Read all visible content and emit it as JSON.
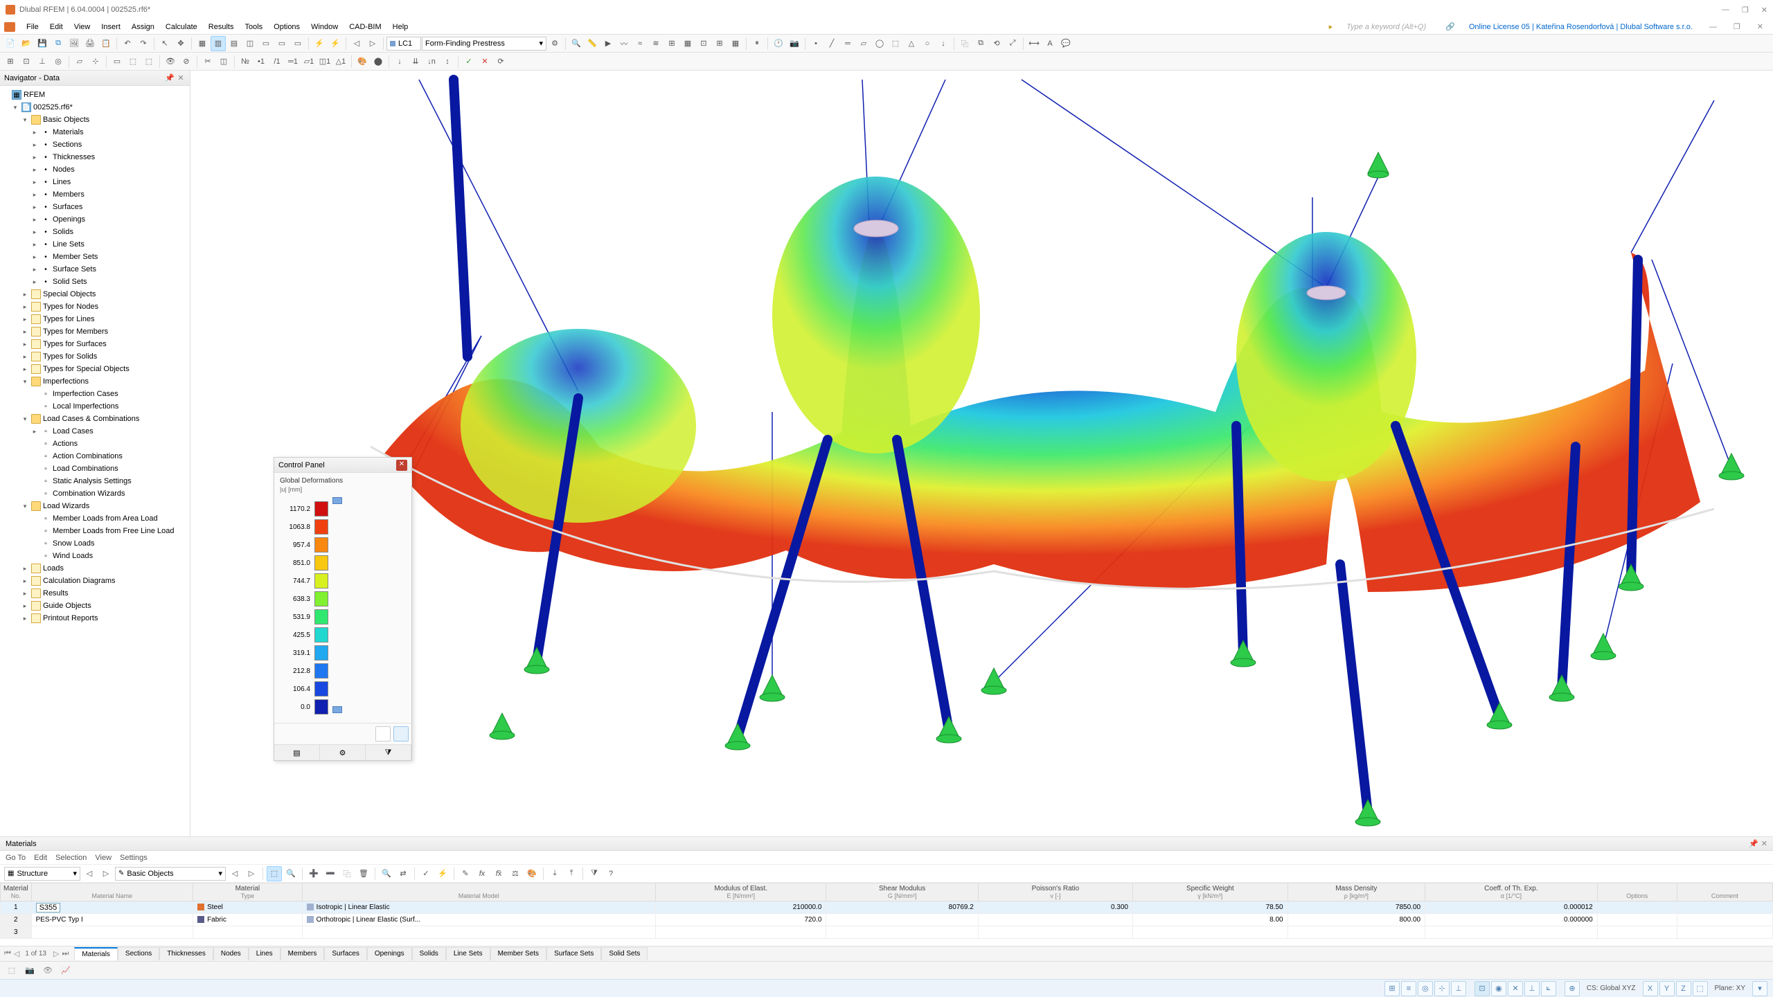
{
  "title": "Dlubal RFEM | 6.04.0004 | 002525.rf6*",
  "win_controls": [
    "—",
    "❐",
    "✕"
  ],
  "menu": {
    "items": [
      "File",
      "Edit",
      "View",
      "Insert",
      "Assign",
      "Calculate",
      "Results",
      "Tools",
      "Options",
      "Window",
      "CAD-BIM",
      "Help"
    ],
    "keyword_placeholder": "Type a keyword (Alt+Q)",
    "license": "Online License 05 | Kateřina Rosendorfová | Dlubal Software s.r.o."
  },
  "load_case": {
    "code": "LC1",
    "name": "Form-Finding Prestress"
  },
  "navigator": {
    "title": "Navigator - Data",
    "root": "RFEM",
    "file": "002525.rf6*",
    "basic": {
      "label": "Basic Objects",
      "children": [
        "Materials",
        "Sections",
        "Thicknesses",
        "Nodes",
        "Lines",
        "Members",
        "Surfaces",
        "Openings",
        "Solids",
        "Line Sets",
        "Member Sets",
        "Surface Sets",
        "Solid Sets"
      ]
    },
    "groups1": [
      "Special Objects",
      "Types for Nodes",
      "Types for Lines",
      "Types for Members",
      "Types for Surfaces",
      "Types for Solids",
      "Types for Special Objects"
    ],
    "imperfections": {
      "label": "Imperfections",
      "children": [
        "Imperfection Cases",
        "Local Imperfections"
      ]
    },
    "loadcases": {
      "label": "Load Cases & Combinations",
      "children": [
        "Load Cases",
        "Actions",
        "Action Combinations",
        "Load Combinations",
        "Static Analysis Settings",
        "Combination Wizards"
      ]
    },
    "wizards": {
      "label": "Load Wizards",
      "children": [
        "Member Loads from Area Load",
        "Member Loads from Free Line Load",
        "Snow Loads",
        "Wind Loads"
      ]
    },
    "groups2": [
      "Loads",
      "Calculation Diagrams",
      "Results",
      "Guide Objects",
      "Printout Reports"
    ]
  },
  "control_panel": {
    "title": "Control Panel",
    "subtitle": "Global Deformations",
    "unit": "|u| [mm]",
    "scale": [
      {
        "v": "0.0",
        "c": "#1020b0"
      },
      {
        "v": "106.4",
        "c": "#1848e0"
      },
      {
        "v": "212.8",
        "c": "#2078f0"
      },
      {
        "v": "319.1",
        "c": "#20a8f0"
      },
      {
        "v": "425.5",
        "c": "#20d8d0"
      },
      {
        "v": "531.9",
        "c": "#30e870"
      },
      {
        "v": "638.3",
        "c": "#80f030"
      },
      {
        "v": "744.7",
        "c": "#d8f020"
      },
      {
        "v": "851.0",
        "c": "#f8c810"
      },
      {
        "v": "957.4",
        "c": "#f88810"
      },
      {
        "v": "1063.8",
        "c": "#f04010"
      },
      {
        "v": "1170.2",
        "c": "#d01010"
      }
    ]
  },
  "materials": {
    "title": "Materials",
    "menu": [
      "Go To",
      "Edit",
      "Selection",
      "View",
      "Settings"
    ],
    "combo1": "Structure",
    "combo2": "Basic Objects",
    "headers": [
      {
        "t": "Material",
        "s": "No."
      },
      {
        "t": "",
        "s": "Material Name"
      },
      {
        "t": "Material",
        "s": "Type"
      },
      {
        "t": "",
        "s": "Material Model"
      },
      {
        "t": "Modulus of Elast.",
        "s": "E [N/mm²]"
      },
      {
        "t": "Shear Modulus",
        "s": "G [N/mm²]"
      },
      {
        "t": "Poisson's Ratio",
        "s": "ν [-]"
      },
      {
        "t": "Specific Weight",
        "s": "γ [kN/m³]"
      },
      {
        "t": "Mass Density",
        "s": "ρ [kg/m³]"
      },
      {
        "t": "Coeff. of Th. Exp.",
        "s": "α [1/°C]"
      },
      {
        "t": "",
        "s": "Options"
      },
      {
        "t": "",
        "s": "Comment"
      }
    ],
    "rows": [
      {
        "no": "1",
        "name": "S355",
        "type": "Steel",
        "tc": "#e07030",
        "model": "Isotropic | Linear Elastic",
        "E": "210000.0",
        "G": "80769.2",
        "v": "0.300",
        "sw": "78.50",
        "md": "7850.00",
        "te": "0.000012"
      },
      {
        "no": "2",
        "name": "PES-PVC Typ I",
        "type": "Fabric",
        "tc": "#5a5a8a",
        "model": "Orthotropic | Linear Elastic (Surf...",
        "E": "720.0",
        "G": "",
        "v": "",
        "sw": "8.00",
        "md": "800.00",
        "te": "0.000000"
      },
      {
        "no": "3",
        "name": "",
        "type": "",
        "tc": "",
        "model": "",
        "E": "",
        "G": "",
        "v": "",
        "sw": "",
        "md": "",
        "te": ""
      }
    ],
    "page": "1 of 13",
    "tabs": [
      "Materials",
      "Sections",
      "Thicknesses",
      "Nodes",
      "Lines",
      "Members",
      "Surfaces",
      "Openings",
      "Solids",
      "Line Sets",
      "Member Sets",
      "Surface Sets",
      "Solid Sets"
    ]
  },
  "status": {
    "cs": "CS: Global XYZ",
    "plane": "Plane: XY"
  }
}
